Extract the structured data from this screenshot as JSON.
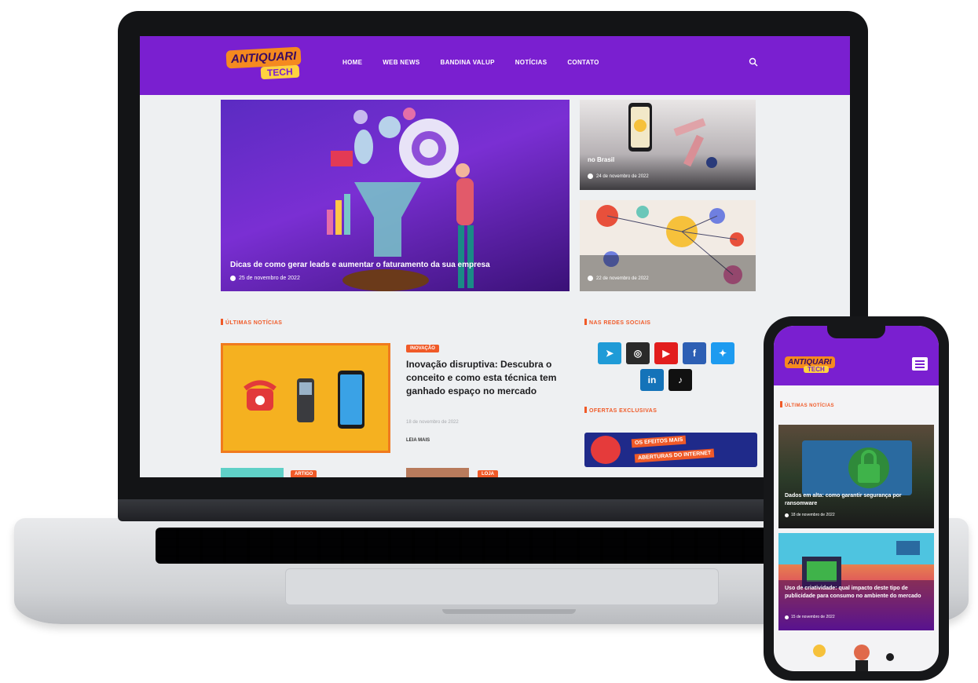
{
  "site": {
    "logo_top": "ANTIQUARI",
    "logo_bottom": "TECH",
    "nav": [
      "HOME",
      "WEB NEWS",
      "BANDINA VALUP",
      "NOTÍCIAS",
      "CONTATO"
    ]
  },
  "hero": {
    "main": {
      "title": "Dicas de como gerar leads e aumentar o faturamento da sua empresa",
      "date": "25 de novembro de 2022"
    },
    "side": [
      {
        "title": "",
        "subtitle": "no Brasil",
        "date": "24 de novembro de 2022"
      },
      {
        "title": "",
        "subtitle": "",
        "date": "22 de novembro de 2022"
      }
    ]
  },
  "sections": {
    "latest": "ÚLTIMAS NOTÍCIAS",
    "social": "NAS REDES SOCIAIS",
    "exclusive": "OFERTAS EXCLUSIVAS"
  },
  "post": {
    "category": "INOVAÇÃO",
    "title": "Inovação disruptiva: Descubra o conceito e como esta técnica tem ganhado espaço no mercado",
    "meta": "18 de novembro de 2022",
    "read_more": "LEIA MAIS",
    "more_badges": [
      "ARTIGO",
      "LOJA"
    ]
  },
  "social_icons": [
    {
      "name": "telegram",
      "glyph": "➤",
      "color": "#1f9bd7"
    },
    {
      "name": "instagram",
      "glyph": "◎",
      "color": "#2a2a2a"
    },
    {
      "name": "youtube",
      "glyph": "▶",
      "color": "#e21d1d"
    },
    {
      "name": "facebook",
      "glyph": "f",
      "color": "#2d5fb4"
    },
    {
      "name": "twitter",
      "glyph": "✦",
      "color": "#1d9bf0"
    },
    {
      "name": "linkedin",
      "glyph": "in",
      "color": "#1473b9"
    },
    {
      "name": "tiktok",
      "glyph": "♪",
      "color": "#111111"
    }
  ],
  "banner": {
    "line1": "OS EFEITOS MAIS",
    "line2": "ABERTURAS DO INTERNET"
  },
  "phone": {
    "section": "ÚLTIMAS NOTÍCIAS",
    "cards": [
      {
        "title": "Dados em alta: como garantir segurança por ransomware",
        "date": "18 de novembro de 2022"
      },
      {
        "title": "Uso de criatividade: qual impacto deste tipo de publicidade para consumo no ambiente do mercado",
        "date": "15 de novembro de 2022"
      }
    ]
  },
  "colors": {
    "brand_purple": "#7a1fd0",
    "accent_orange": "#f05a28"
  }
}
